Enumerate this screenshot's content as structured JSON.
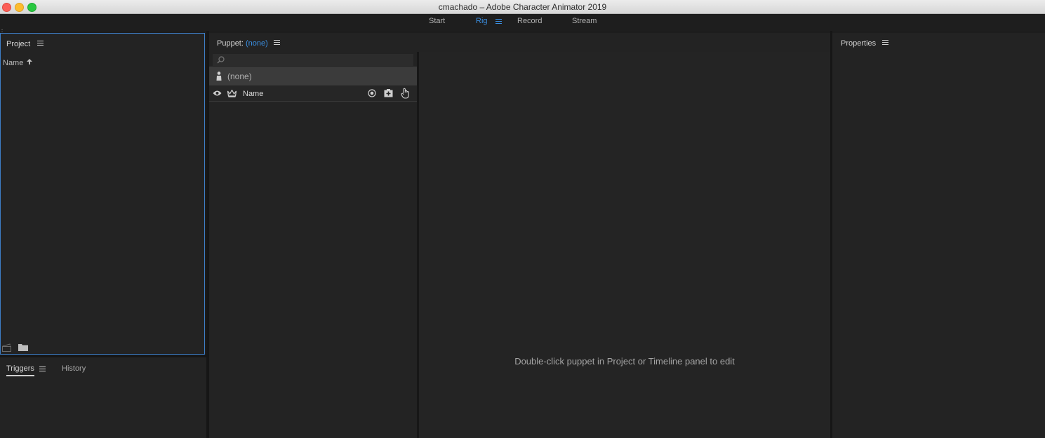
{
  "window": {
    "title": "cmachado – Adobe Character Animator 2019"
  },
  "workspaces": [
    {
      "label": "Start",
      "active": false
    },
    {
      "label": "Rig",
      "active": true
    },
    {
      "label": "Record",
      "active": false
    },
    {
      "label": "Stream",
      "active": false
    }
  ],
  "project_panel": {
    "title": "Project",
    "column_header": "Name",
    "sort_direction": "ascending"
  },
  "triggers_panel": {
    "tabs": [
      {
        "label": "Triggers",
        "active": true
      },
      {
        "label": "History",
        "active": false
      }
    ]
  },
  "puppet_panel": {
    "title_prefix": "Puppet:",
    "puppet_name": "(none)",
    "search_placeholder": "",
    "root_row_label": "(none)",
    "column_header": "Name",
    "canvas_hint": "Double-click puppet in Project or Timeline panel to edit"
  },
  "properties_panel": {
    "title": "Properties"
  },
  "colors": {
    "accent": "#3a8fe3",
    "panel_bg": "#232323",
    "app_bg": "#1d1d1d"
  }
}
